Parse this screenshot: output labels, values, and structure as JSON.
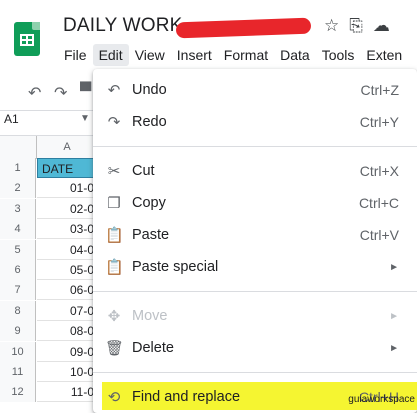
{
  "header": {
    "doc_title": "DAILY WORK-",
    "menu": [
      "File",
      "Edit",
      "View",
      "Insert",
      "Format",
      "Data",
      "Tools",
      "Exten"
    ]
  },
  "namebox": {
    "value": "A1"
  },
  "grid": {
    "col_a": "A",
    "rows": [
      "1",
      "2",
      "3",
      "4",
      "5",
      "6",
      "7",
      "8",
      "9",
      "10",
      "11",
      "12"
    ],
    "cells": [
      "DATE",
      "01-0",
      "02-0",
      "03-0",
      "04-0",
      "05-0",
      "06-0",
      "07-0",
      "08-0",
      "09-0",
      "10-0",
      "11-0"
    ]
  },
  "edit_menu": {
    "items": [
      {
        "label": "Undo",
        "shortcut": "Ctrl+Z",
        "icon": "undo-icon"
      },
      {
        "label": "Redo",
        "shortcut": "Ctrl+Y",
        "icon": "redo-icon"
      },
      {
        "label": "Cut",
        "shortcut": "Ctrl+X",
        "icon": "scissors-icon"
      },
      {
        "label": "Copy",
        "shortcut": "Ctrl+C",
        "icon": "copy-icon"
      },
      {
        "label": "Paste",
        "shortcut": "Ctrl+V",
        "icon": "clipboard-icon"
      },
      {
        "label": "Paste special",
        "shortcut": "",
        "icon": "clipboard-icon"
      },
      {
        "label": "Move",
        "shortcut": "",
        "icon": "move-icon"
      },
      {
        "label": "Delete",
        "shortcut": "",
        "icon": "trash-icon"
      },
      {
        "label": "Find and replace",
        "shortcut": "Ctrl+H",
        "icon": "find-replace-icon"
      }
    ]
  },
  "watermark": "guiaworkspace",
  "colors": {
    "highlight": "#f5f531",
    "header_cell": "#4fb8d5",
    "redaction": "#e8262b"
  }
}
